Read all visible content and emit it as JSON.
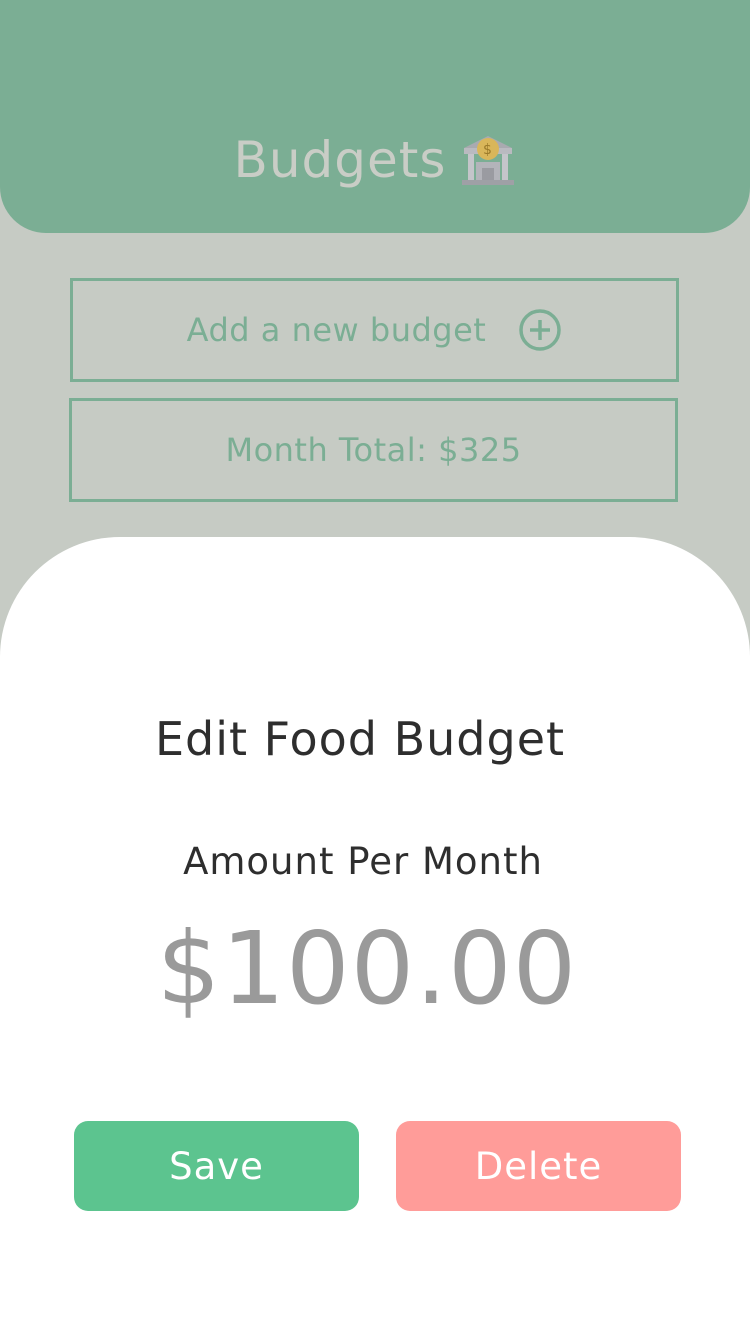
{
  "header": {
    "title": "Budgets",
    "icon": "bank-icon"
  },
  "add_budget": {
    "label": "Add a new budget",
    "icon": "plus-circle-icon"
  },
  "month_total": {
    "label": "Month Total: $325"
  },
  "edit_sheet": {
    "title": "Edit Food Budget",
    "amount_label": "Amount Per Month",
    "amount_value": "$100.00",
    "save_label": "Save",
    "delete_label": "Delete"
  },
  "colors": {
    "header_bg": "#7bae94",
    "backdrop": "#c6cbc4",
    "save": "#5cc48f",
    "delete": "#ff9c99",
    "amount_text": "#9a9a9a"
  }
}
